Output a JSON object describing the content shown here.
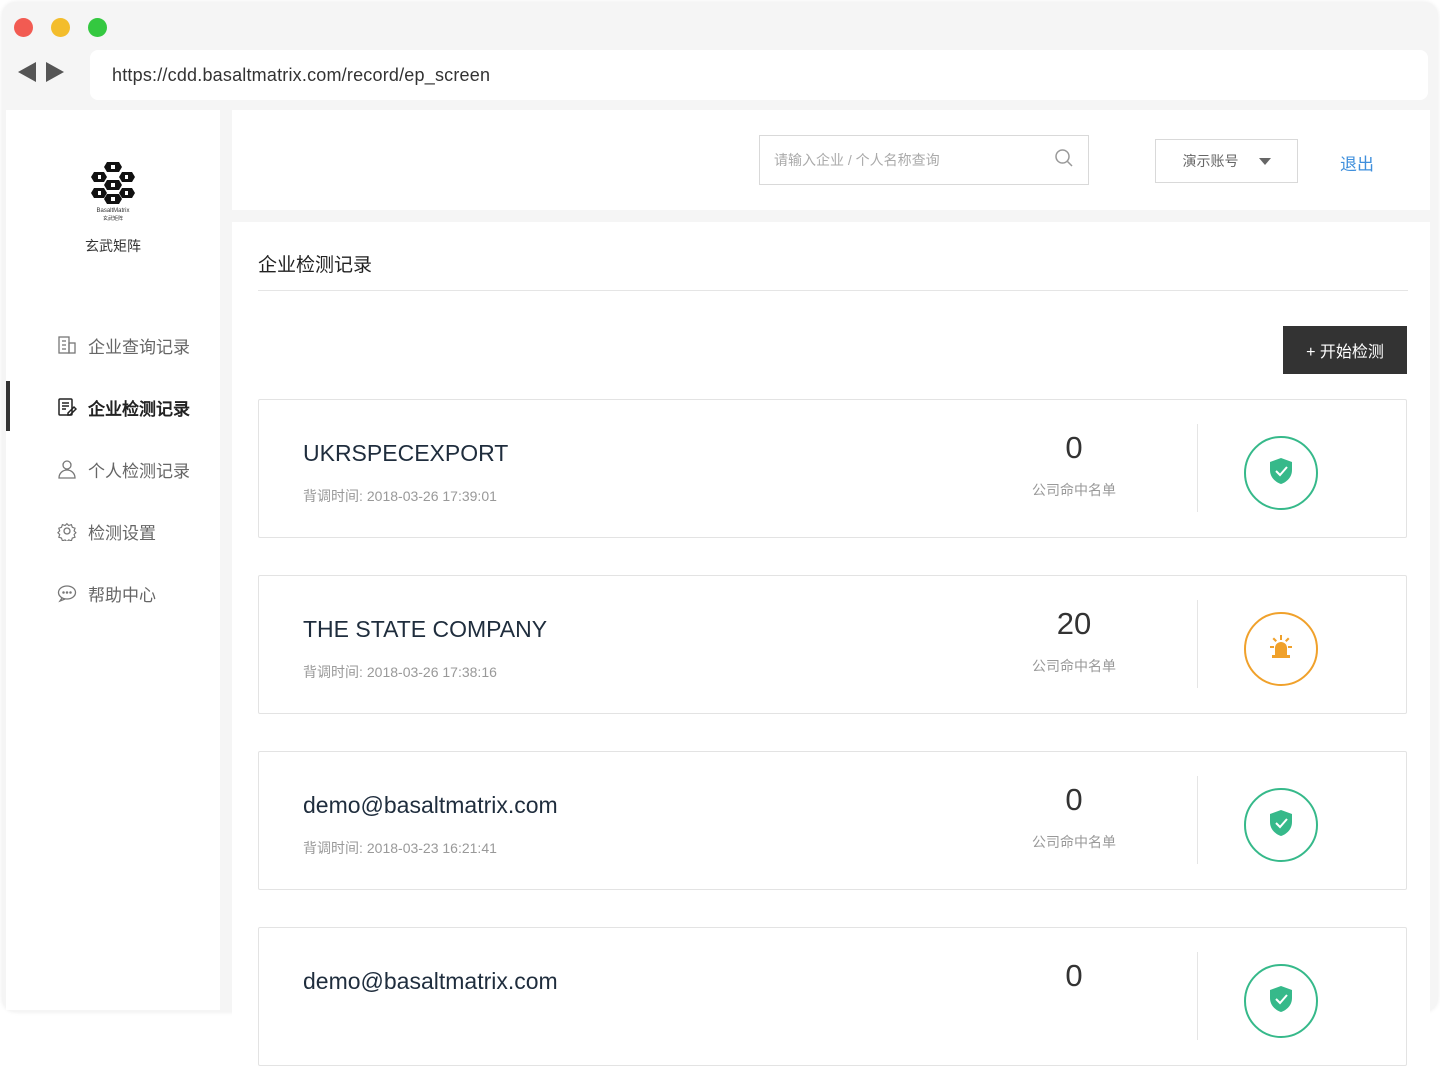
{
  "browser": {
    "url": "https://cdd.basaltmatrix.com/record/ep_screen"
  },
  "sidebar": {
    "logo_text": "BasaltMatrix",
    "logo_subtext": "玄武矩阵",
    "brand_name": "玄武矩阵",
    "items": [
      {
        "label": "企业查询记录",
        "icon": "building-icon",
        "active": false
      },
      {
        "label": "企业检测记录",
        "icon": "document-edit-icon",
        "active": true
      },
      {
        "label": "个人检测记录",
        "icon": "person-icon",
        "active": false
      },
      {
        "label": "检测设置",
        "icon": "gear-icon",
        "active": false
      },
      {
        "label": "帮助中心",
        "icon": "chat-bubble-icon",
        "active": false
      }
    ]
  },
  "header": {
    "search_placeholder": "请输入企业 / 个人名称查询",
    "account_label": "演示账号",
    "logout_label": "退出"
  },
  "main": {
    "title": "企业检测记录",
    "start_button": "+ 开始检测",
    "time_label": "背调时间:",
    "count_caption": "公司命中名单",
    "records": [
      {
        "name": "UKRSPECEXPORT",
        "time": "2018-03-26 17:39:01",
        "count": "0",
        "status": "safe"
      },
      {
        "name": "THE STATE COMPANY",
        "time": "2018-03-26 17:38:16",
        "count": "20",
        "status": "alert"
      },
      {
        "name": "demo@basaltmatrix.com",
        "time": "2018-03-23 16:21:41",
        "count": "0",
        "status": "safe"
      },
      {
        "name": "demo@basaltmatrix.com",
        "time": "",
        "count": "0",
        "status": "safe"
      }
    ]
  },
  "colors": {
    "safe": "#36b98a",
    "alert": "#f0a12b",
    "link": "#3f8fdc",
    "button_dark": "#333333"
  }
}
